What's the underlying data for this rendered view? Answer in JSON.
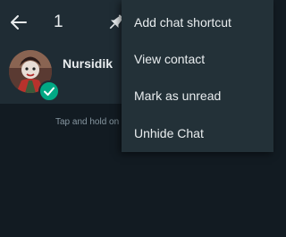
{
  "colors": {
    "background": "#121b22",
    "appbar": "#1f2c34",
    "menu": "#233138",
    "text_primary": "#e9edef",
    "text_secondary": "#8696a0",
    "accent": "#00a884"
  },
  "appbar": {
    "back_icon": "arrow-left-icon",
    "selected_count": "1",
    "pin_icon": "pin-icon"
  },
  "chat": {
    "name": "Nursidik",
    "avatar_icon": "avatar",
    "selected_icon": "check-icon"
  },
  "hint": {
    "text": "Tap and hold on"
  },
  "menu": {
    "items": [
      {
        "label": "Add chat shortcut"
      },
      {
        "label": "View contact"
      },
      {
        "label": "Mark as unread"
      },
      {
        "label": "Unhide Chat"
      }
    ]
  }
}
